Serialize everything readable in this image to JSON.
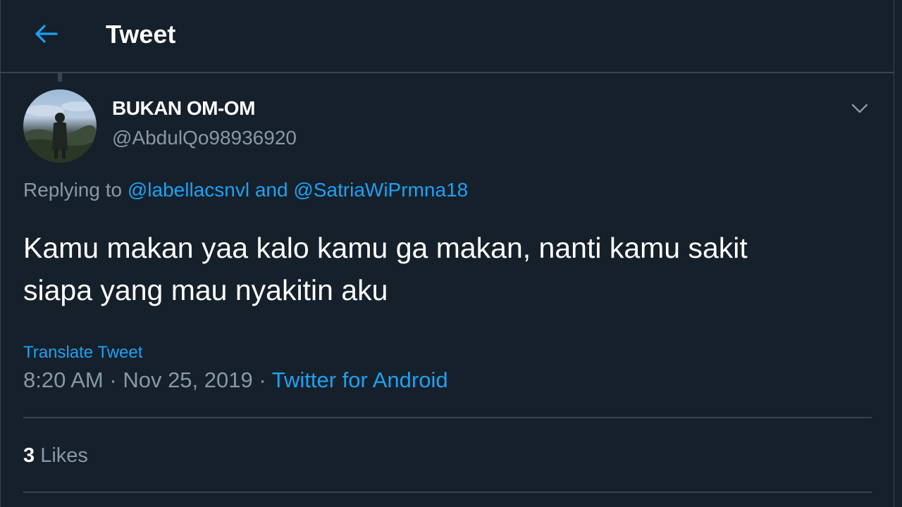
{
  "header": {
    "title": "Tweet",
    "back_icon": "arrow-left-icon"
  },
  "tweet": {
    "author": {
      "name": "BUKAN OM-OM",
      "handle": "@AbdulQo98936920"
    },
    "reply": {
      "prefix": "Replying to",
      "mention_1": "@labellacsnvl",
      "conjunction": "and",
      "mention_2": "@SatriaWiPrmna18"
    },
    "text_line_1": "Kamu makan yaa kalo kamu ga makan, nanti kamu sakit",
    "text_line_2": "siapa yang mau nyakitin aku",
    "translate_label": "Translate Tweet",
    "time": "8:20 AM",
    "separator": "·",
    "date": "Nov 25, 2019",
    "source": "Twitter for Android",
    "likes_count": "3",
    "likes_label": "Likes",
    "more_icon": "chevron-down-icon"
  },
  "colors": {
    "background": "#15202b",
    "border": "#38444d",
    "accent": "#1da1f2",
    "secondary_text": "#8899a6",
    "primary_text": "#ffffff"
  }
}
